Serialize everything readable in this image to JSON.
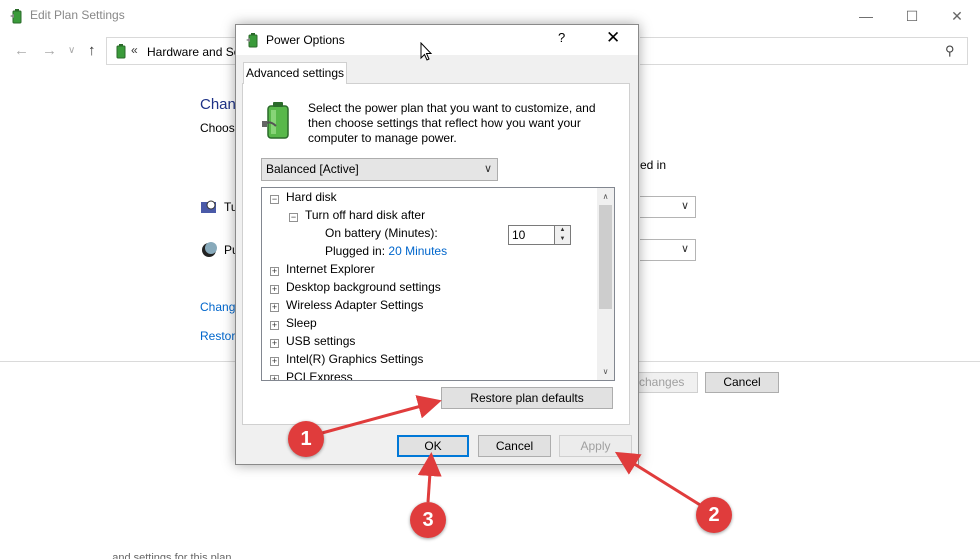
{
  "bg_window": {
    "title": "Edit Plan Settings",
    "address": "Hardware and So",
    "heading": "Chan",
    "subheading": "Choos",
    "plugged_in_header": "ed in",
    "row1_label": "Tu",
    "row2_label": "Pu",
    "link1": "Chang",
    "link2": "Restor",
    "save_label": "changes",
    "cancel_label": "Cancel",
    "bottom_text": "... and settings for this plan ..."
  },
  "dialog": {
    "title": "Power Options",
    "help": "?",
    "close": "✕",
    "tab": "Advanced settings",
    "intro": "Select the power plan that you want to customize, and then choose settings that reflect how you want your computer to manage power.",
    "plan_selected": "Balanced [Active]",
    "tree": {
      "hard_disk": "Hard disk",
      "turn_off": "Turn off hard disk after",
      "on_battery_label": "On battery (Minutes):",
      "on_battery_value": "10",
      "plugged_in_label": "Plugged in:",
      "plugged_in_value": "20 Minutes",
      "items": [
        "Internet Explorer",
        "Desktop background settings",
        "Wireless Adapter Settings",
        "Sleep",
        "USB settings",
        "Intel(R) Graphics Settings",
        "PCI Express"
      ]
    },
    "restore_label": "Restore plan defaults",
    "ok_label": "OK",
    "cancel_label": "Cancel",
    "apply_label": "Apply"
  },
  "annotations": {
    "marker1": "1",
    "marker2": "2",
    "marker3": "3",
    "color": "#e03c3c"
  }
}
